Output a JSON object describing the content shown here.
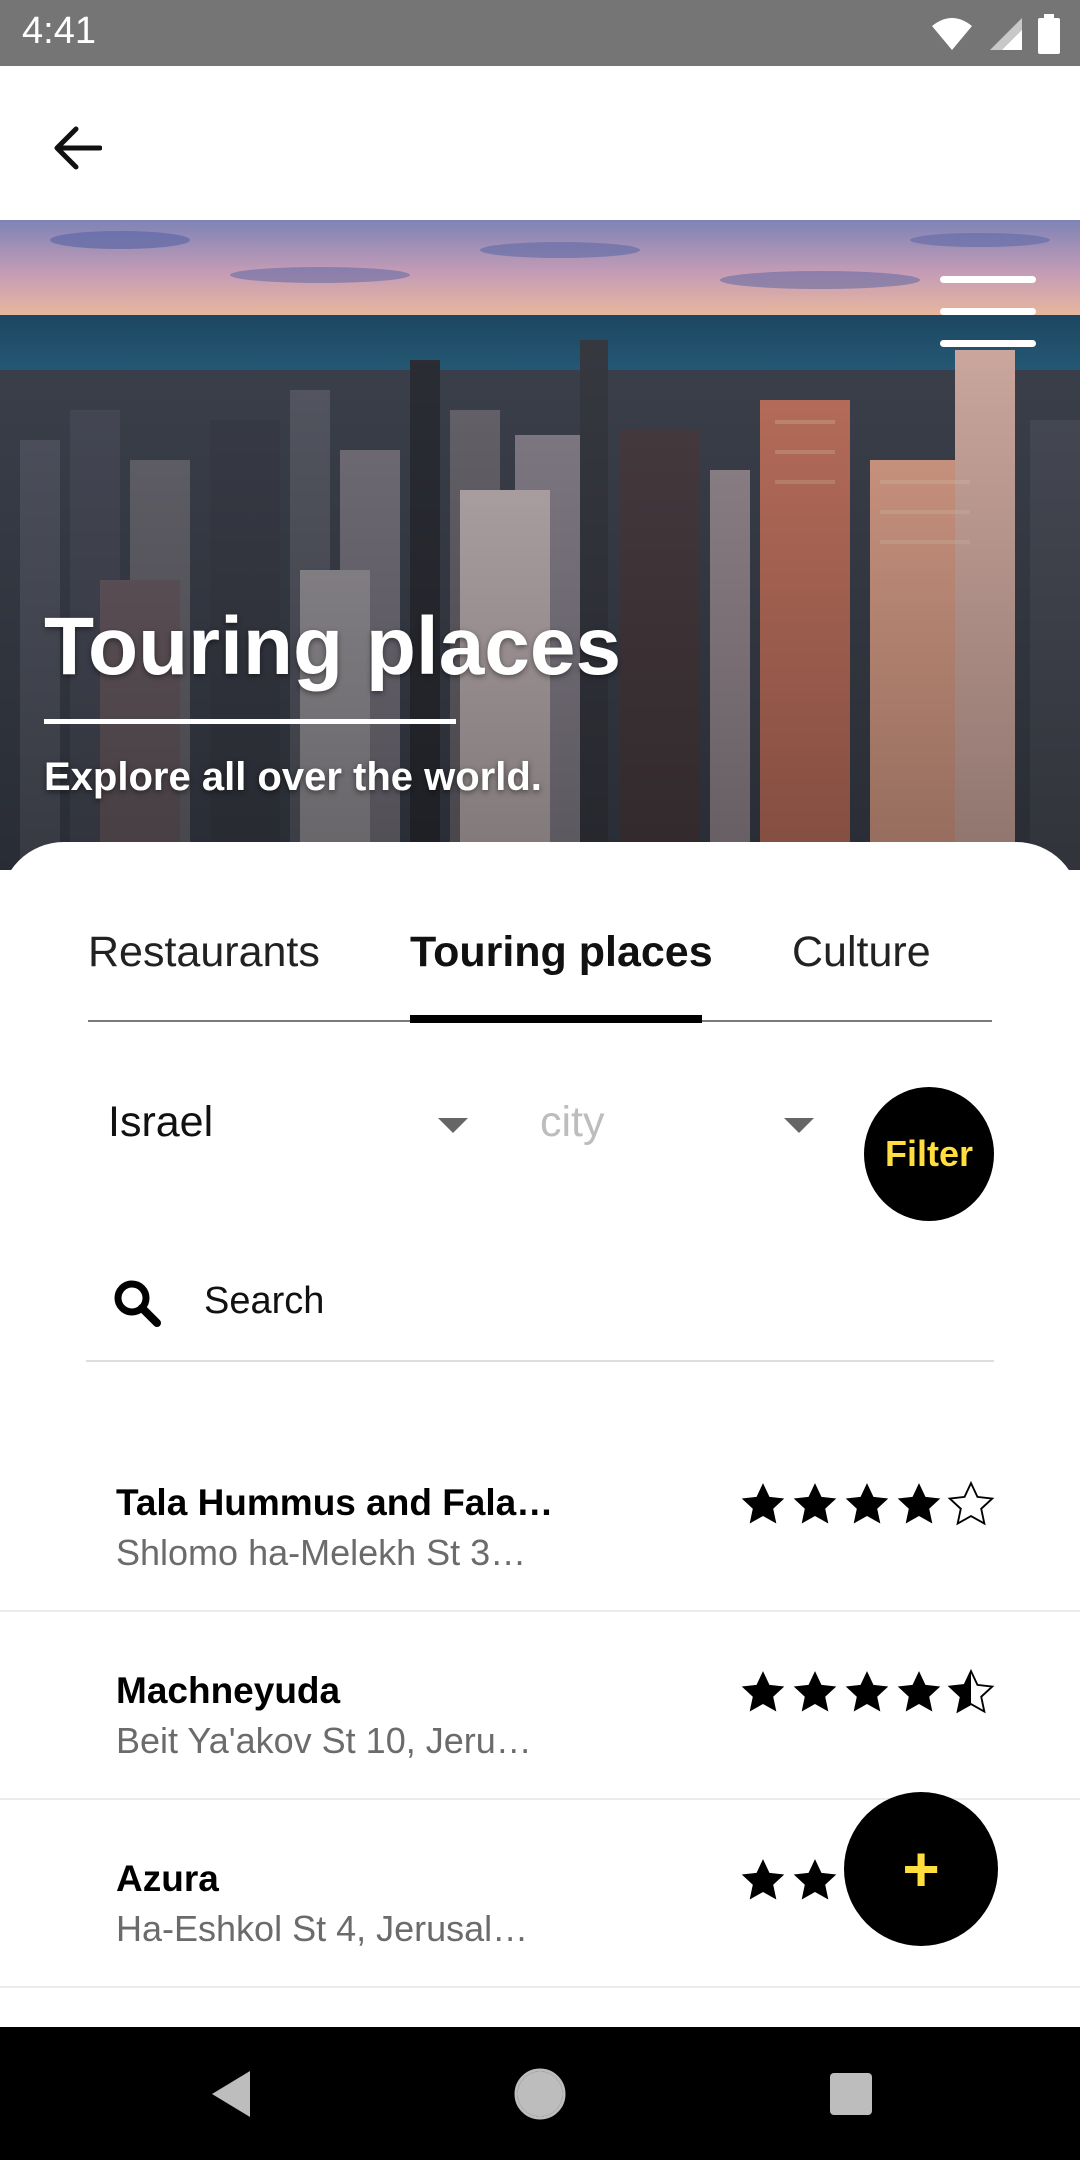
{
  "status_bar": {
    "time": "4:41",
    "icons": [
      "wifi-icon",
      "signal-icon",
      "battery-icon"
    ]
  },
  "app_bar": {
    "back_icon": "arrow-left-icon"
  },
  "hero": {
    "title": "Touring places",
    "subtitle": "Explore all over the world.",
    "menu_icon": "hamburger-menu-icon"
  },
  "tabs": [
    {
      "label": "Restaurants",
      "active": false
    },
    {
      "label": "Touring places",
      "active": true
    },
    {
      "label": "Culture",
      "active": false
    }
  ],
  "filters": {
    "country": "Israel",
    "city_placeholder": "city",
    "filter_label": "Filter"
  },
  "search": {
    "placeholder": "Search",
    "icon": "search-icon"
  },
  "places": [
    {
      "name": "Tala Hummus and Fala…",
      "address": "Shlomo ha-Melekh St 3…",
      "rating": 4
    },
    {
      "name": "Machneyuda",
      "address": "Beit Ya'akov St 10, Jeru…",
      "rating": 4.5
    },
    {
      "name": "Azura",
      "address": "Ha-Eshkol St 4, Jerusal…",
      "rating": 2
    }
  ],
  "fab": {
    "label": "+"
  },
  "colors": {
    "accent": "#ffde3d",
    "primary": "#000000",
    "status_bar": "#757575",
    "muted_text": "#6b6b6b"
  },
  "nav_bar": {
    "icons": [
      "back-triangle-icon",
      "home-circle-icon",
      "recents-square-icon"
    ]
  }
}
